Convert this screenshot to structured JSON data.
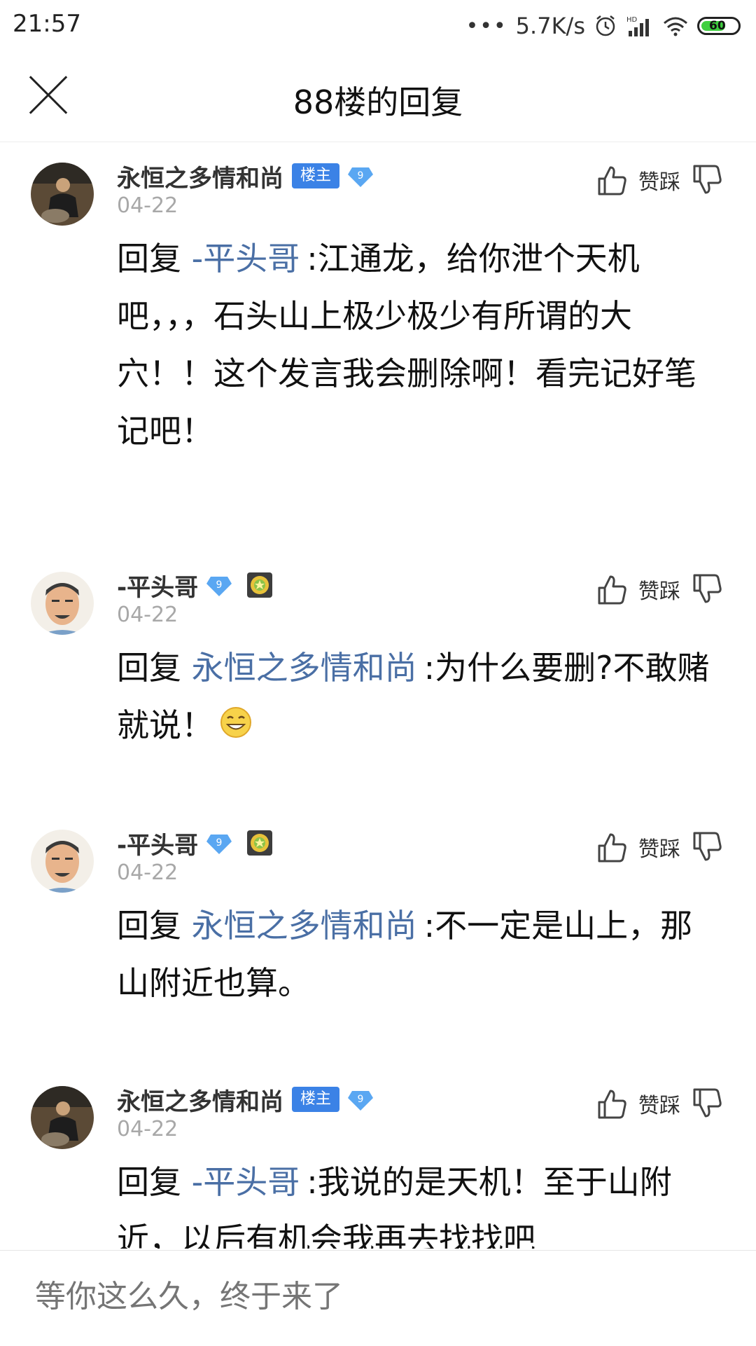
{
  "status_bar": {
    "time": "21:57",
    "dots": "•••",
    "network_speed": "5.7K/s",
    "signal_label": "HD",
    "battery": "60",
    "battery_color": "#3fcf3f"
  },
  "header": {
    "close_icon": "close-icon",
    "title": "88楼的回复"
  },
  "comments": [
    {
      "author": "永恒之多情和尚",
      "louzhu_badge": "楼主",
      "level": "9",
      "date": "04-22",
      "like_label": "赞踩",
      "reply_prefix": "回复",
      "mention": "-平头哥",
      "text": ":江通龙，给你泄个天机吧，，，石头山上极少极少有所谓的大穴！！这个发言我会删除啊！看完记好笔记吧！"
    },
    {
      "author": "-平头哥",
      "level": "9",
      "date": "04-22",
      "like_label": "赞踩",
      "reply_prefix": "回复",
      "mention": "永恒之多情和尚",
      "text": ":为什么要删?不敢赌就说！",
      "emoji": "grin-emoji"
    },
    {
      "author": "-平头哥",
      "level": "9",
      "date": "04-22",
      "like_label": "赞踩",
      "reply_prefix": "回复",
      "mention": "永恒之多情和尚",
      "text": ":不一定是山上，那山附近也算。"
    },
    {
      "author": "永恒之多情和尚",
      "louzhu_badge": "楼主",
      "level": "9",
      "date": "04-22",
      "like_label": "赞踩",
      "reply_prefix": "回复",
      "mention": "-平头哥",
      "text": ":我说的是天机！至于山附近，以后有机会我再去找找吧"
    }
  ],
  "reply_box": {
    "placeholder": "等你这么久，终于来了"
  },
  "colors": {
    "accent": "#3b82e6",
    "mention": "#4a6fa5",
    "date": "#a8a8a8"
  }
}
